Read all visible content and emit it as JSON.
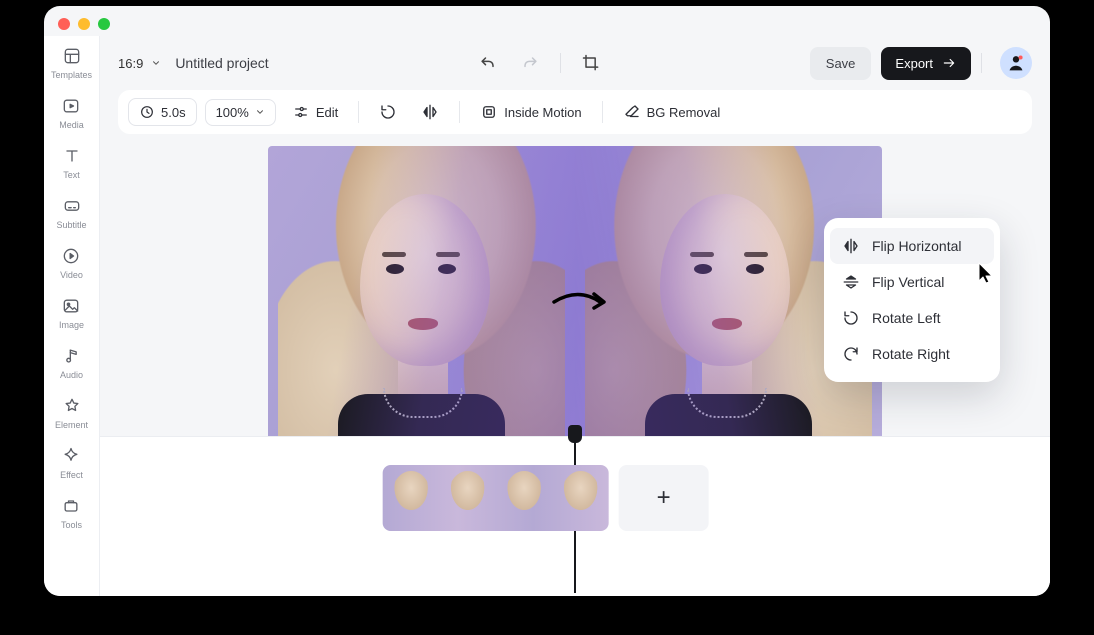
{
  "sidebar": {
    "items": [
      {
        "label": "Templates"
      },
      {
        "label": "Media"
      },
      {
        "label": "Text"
      },
      {
        "label": "Subtitle"
      },
      {
        "label": "Video"
      },
      {
        "label": "Image"
      },
      {
        "label": "Audio"
      },
      {
        "label": "Element"
      },
      {
        "label": "Effect"
      },
      {
        "label": "Tools"
      }
    ]
  },
  "topbar": {
    "aspect": "16:9",
    "project_name": "Untitled project",
    "save_label": "Save",
    "export_label": "Export"
  },
  "toolbar": {
    "duration": "5.0s",
    "zoom": "100%",
    "edit_label": "Edit",
    "inside_motion_label": "Inside Motion",
    "bg_removal_label": "BG Removal"
  },
  "context_menu": {
    "items": [
      {
        "label": "Flip Horizontal"
      },
      {
        "label": "Flip Vertical"
      },
      {
        "label": "Rotate Left"
      },
      {
        "label": "Rotate Right"
      }
    ]
  },
  "timeline": {
    "add_label": "+"
  }
}
